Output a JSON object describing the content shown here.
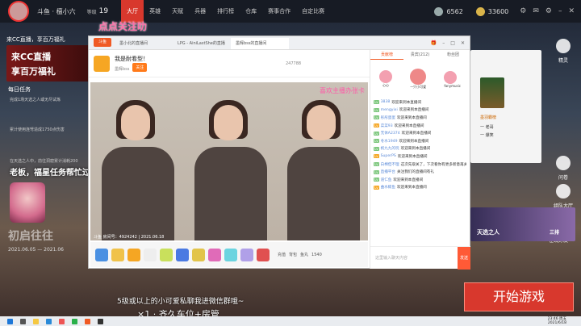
{
  "topbar": {
    "nickname": "斗鱼 · 檀小六",
    "level_label": "等级",
    "level": "19",
    "nav": [
      "大厅",
      "英雄",
      "天赋",
      "兵器",
      "排行榜",
      "仓库",
      "赛事合作",
      "自定比赛"
    ],
    "active_nav": "大厅",
    "currency1": "6562",
    "currency2": "33600"
  },
  "left_panel": {
    "title": "来CC直播，享百万福礼",
    "banner_line1": "来CC直播",
    "banner_line2": "享百万福礼",
    "daily_title": "每日任务",
    "task1": "完成1场天选之人或无尽试炼",
    "task2": "累计使用连弩造成1750点伤害",
    "task3": "在天选之人中，前往洞窟累计消耗200",
    "callout": "老板，福星任务帮忙过一过嘛~",
    "promo_title": "初启往往",
    "promo_dates": "2021.06.05 — 2021.06"
  },
  "stream": {
    "tabs": [
      "墨小北的直播间",
      "LPG - AiniLastShe的直播",
      "墨辉bss的直播间"
    ],
    "room_title": "我是耐看型！",
    "host": "墨辉bss",
    "follow_label": "关注",
    "follow_count": "247788",
    "overlay_text": "喜欢主播办张卡",
    "footer": "斗鱼 房间号：4924242 | 2021.06.18",
    "live_overlay": "点点关注叻",
    "chat_tabs": [
      "贡献榜",
      "贵宾(212)",
      "粉丝团"
    ],
    "top_fans": [
      "心心",
      "一只小可爱",
      "fanymusic"
    ],
    "messages": [
      {
        "user": "3838",
        "text": "欢迎来到本直播间"
      },
      {
        "user": "mengyixi",
        "text": "欢迎来到本直播间"
      },
      {
        "user": "彤彤蛋蛋",
        "text": "欢迎来到本直播间"
      },
      {
        "user": "菜菜93",
        "text": "欢迎来到本直播间"
      },
      {
        "user": "无体A2374",
        "text": "欢迎来到本直播间"
      },
      {
        "user": "冬水1949",
        "text": "欢迎来到本直播间"
      },
      {
        "user": "帆九九的玩",
        "text": "欢迎来到本直播间"
      },
      {
        "user": "SuperPS",
        "text": "欢迎来到本直播间"
      },
      {
        "user": "白棉但不理",
        "text": "这次先取关了，下次看你有更多新意再关注"
      },
      {
        "user": "直播平台",
        "text": "关注我们的直播间有礼"
      },
      {
        "user": "道仁鱼",
        "text": "欢迎来到本直播间"
      },
      {
        "user": "曲水鲸鱼",
        "text": "欢迎来到本直播间"
      }
    ],
    "chat_placeholder": "这里输入聊天内容",
    "send_label": "发送",
    "gift_labels": [
      "充值",
      "鱼丸",
      "背包"
    ],
    "balance": "1540"
  },
  "right": {
    "elf_label": "精灵",
    "wenjuan_label": "问卷",
    "team_label": "组队大厅",
    "card_title": "墨羽霸榜",
    "card_line1": "一 老哥",
    "card_line2": "一 爆笑",
    "promo_label": "天选之人",
    "promo_right": "三排",
    "mode_label": "007",
    "friends_label": "在线好友",
    "start_button": "开始游戏"
  },
  "subtitles": {
    "line1": "5级或以上的小可爱私聊我进微信群哦~",
    "line2": "×1 · 齐久车位+房管"
  },
  "taskbar": {
    "time": "23:46 周五",
    "date": "2021/6/18"
  },
  "colors": {
    "accent": "#d8382d",
    "douyu_orange": "#f05a24"
  }
}
